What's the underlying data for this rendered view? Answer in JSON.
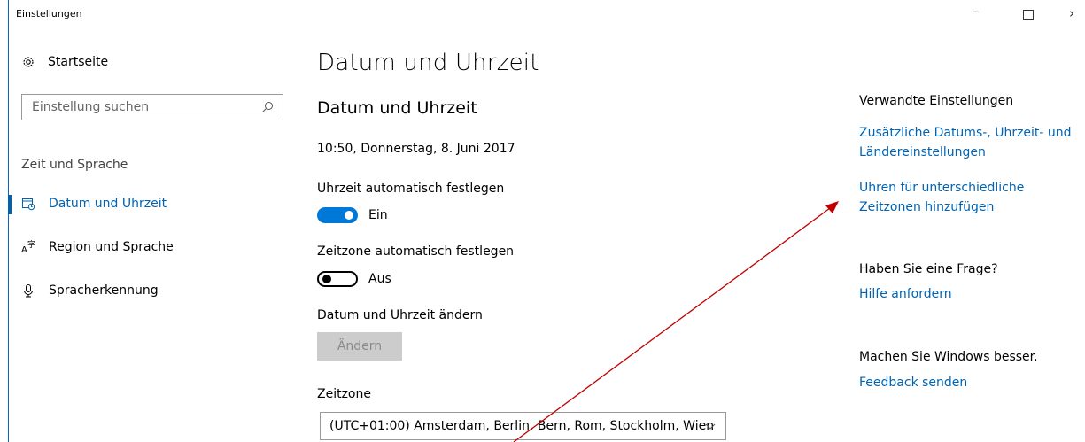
{
  "window": {
    "title": "Einstellungen",
    "minimize": "–",
    "close": "›"
  },
  "sidebar": {
    "home_label": "Startseite",
    "search_placeholder": "Einstellung suchen",
    "group_heading": "Zeit und Sprache",
    "items": [
      {
        "label": "Datum und Uhrzeit",
        "icon": "calendar-clock-icon",
        "active": true
      },
      {
        "label": "Region und Sprache",
        "icon": "language-icon",
        "active": false
      },
      {
        "label": "Spracherkennung",
        "icon": "microphone-icon",
        "active": false
      }
    ]
  },
  "main": {
    "page_title": "Datum und Uhrzeit",
    "section_title": "Datum und Uhrzeit",
    "current_time": "10:50, Donnerstag, 8. Juni 2017",
    "auto_time": {
      "label": "Uhrzeit automatisch festlegen",
      "state": "Ein",
      "on": true
    },
    "auto_timezone": {
      "label": "Zeitzone automatisch festlegen",
      "state": "Aus",
      "on": false
    },
    "change": {
      "label": "Datum und Uhrzeit ändern",
      "button": "Ändern"
    },
    "timezone": {
      "label": "Zeitzone",
      "value": "(UTC+01:00) Amsterdam, Berlin, Bern, Rom, Stockholm, Wien"
    }
  },
  "related": {
    "heading": "Verwandte Einstellungen",
    "links": [
      {
        "line1": "Zusätzliche Datums-, Uhrzeit- und",
        "line2": "Ländereinstellungen"
      },
      {
        "line1": "Uhren für unterschiedliche",
        "line2": "Zeitzonen hinzufügen"
      }
    ],
    "question_heading": "Haben Sie eine Frage?",
    "help_link": "Hilfe anfordern",
    "improve_heading": "Machen Sie Windows besser.",
    "feedback_link": "Feedback senden"
  },
  "colors": {
    "accent": "#0078d7",
    "link": "#0063b1",
    "annotation_arrow": "#c00000"
  }
}
